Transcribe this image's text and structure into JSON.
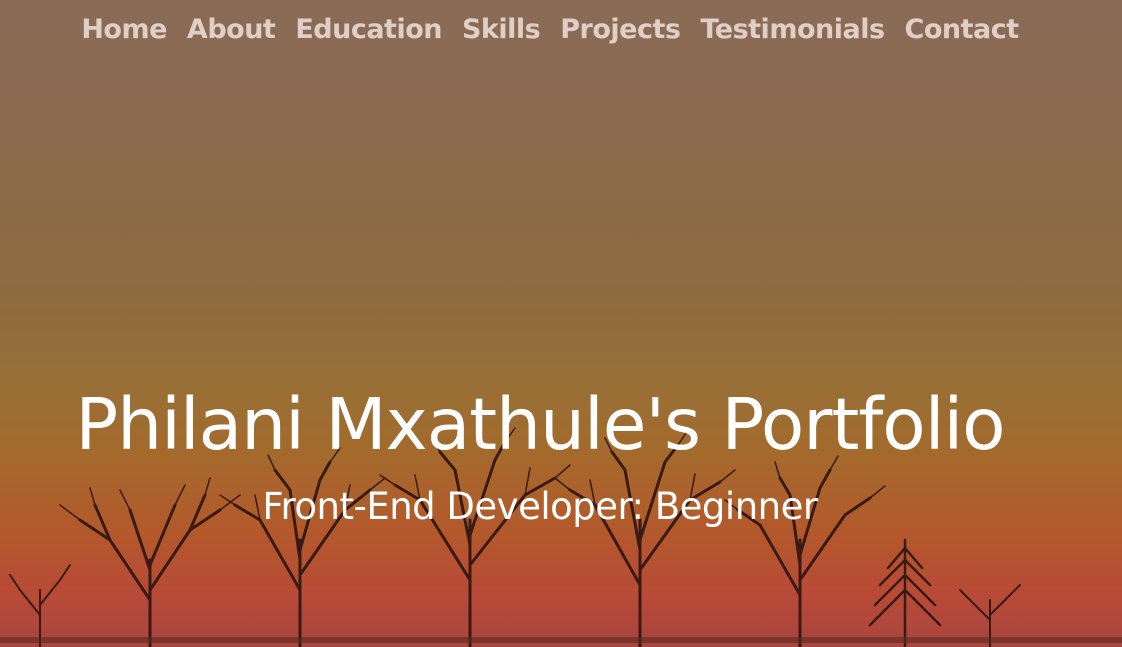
{
  "nav": {
    "items": [
      {
        "label": "Home"
      },
      {
        "label": "About"
      },
      {
        "label": "Education"
      },
      {
        "label": "Skills"
      },
      {
        "label": "Projects"
      },
      {
        "label": "Testimonials"
      },
      {
        "label": "Contact"
      }
    ]
  },
  "hero": {
    "title": "Philani Mxathule's Portfolio",
    "subtitle": "Front-End Developer: Beginner",
    "background_top_color": "#8a6b57",
    "background_bottom_color": "#a8453f",
    "text_color": "#ffffff",
    "nav_text_color": "#e0cfc6"
  }
}
